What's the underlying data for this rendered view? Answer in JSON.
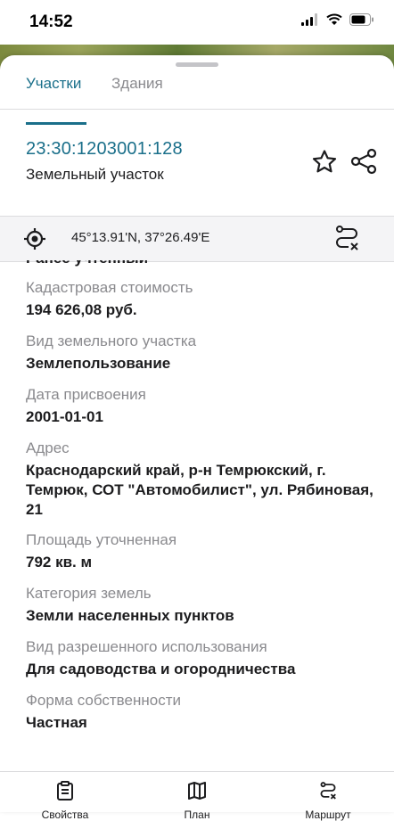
{
  "status_bar": {
    "time": "14:52",
    "icons": [
      "signal-icon",
      "wifi-icon",
      "battery-icon"
    ]
  },
  "tabs": [
    {
      "label": "Участки",
      "active": true
    },
    {
      "label": "Здания",
      "active": false
    }
  ],
  "parcel": {
    "cadastral_number": "23:30:1203001:128",
    "type": "Земельный участок"
  },
  "location": {
    "coordinates": "45°13.91'N, 37°26.49'E"
  },
  "partial_top_text": "Ранее учтенный",
  "fields": [
    {
      "label": "Кадастровая стоимость",
      "value": "194 626,08 руб."
    },
    {
      "label": "Вид земельного участка",
      "value": "Землепользование"
    },
    {
      "label": "Дата присвоения",
      "value": "2001-01-01"
    },
    {
      "label": "Адрес",
      "value": "Краснодарский край, р-н Темрюкский, г. Темрюк, СОТ \"Автомобилист\", ул. Рябиновая, 21"
    },
    {
      "label": "Площадь уточненная",
      "value": "792 кв. м"
    },
    {
      "label": "Категория земель",
      "value": "Земли населенных пунктов"
    },
    {
      "label": "Вид разрешенного использования",
      "value": "Для садоводства и огородничества"
    },
    {
      "label": "Форма собственности",
      "value": "Частная"
    }
  ],
  "bottom_nav": [
    {
      "label": "Свойства",
      "icon": "clipboard-icon"
    },
    {
      "label": "План",
      "icon": "map-icon"
    },
    {
      "label": "Маршрут",
      "icon": "route-icon"
    }
  ],
  "colors": {
    "accent": "#1a6f8a",
    "label_gray": "#8a8a8e",
    "text": "#1c1c1e"
  }
}
